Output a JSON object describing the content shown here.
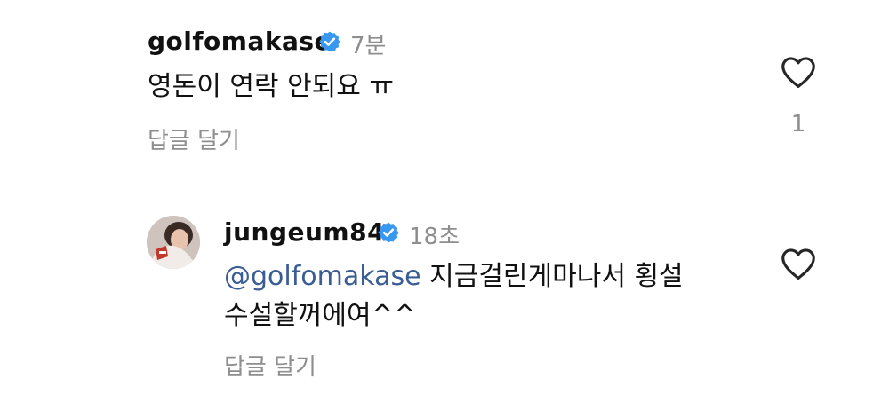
{
  "comments": [
    {
      "username": "golfomakase",
      "time": "7분",
      "text": "영돈이 연락 안되요 ㅠ",
      "reply_label": "답글 달기",
      "likes": "1"
    },
    {
      "username": "jungeum84",
      "time": "18초",
      "mention": "@golfomakase",
      "text_line1": " 지금걸린게마나서 횡설",
      "text_line2": "수설할꺼에여^^",
      "reply_label": "답글 달기"
    }
  ],
  "colors": {
    "verified": "#3897f0",
    "mention": "#3b5d96",
    "secondary_text": "#8e8e8e"
  },
  "icons": [
    "verified-badge-icon",
    "heart-icon"
  ]
}
